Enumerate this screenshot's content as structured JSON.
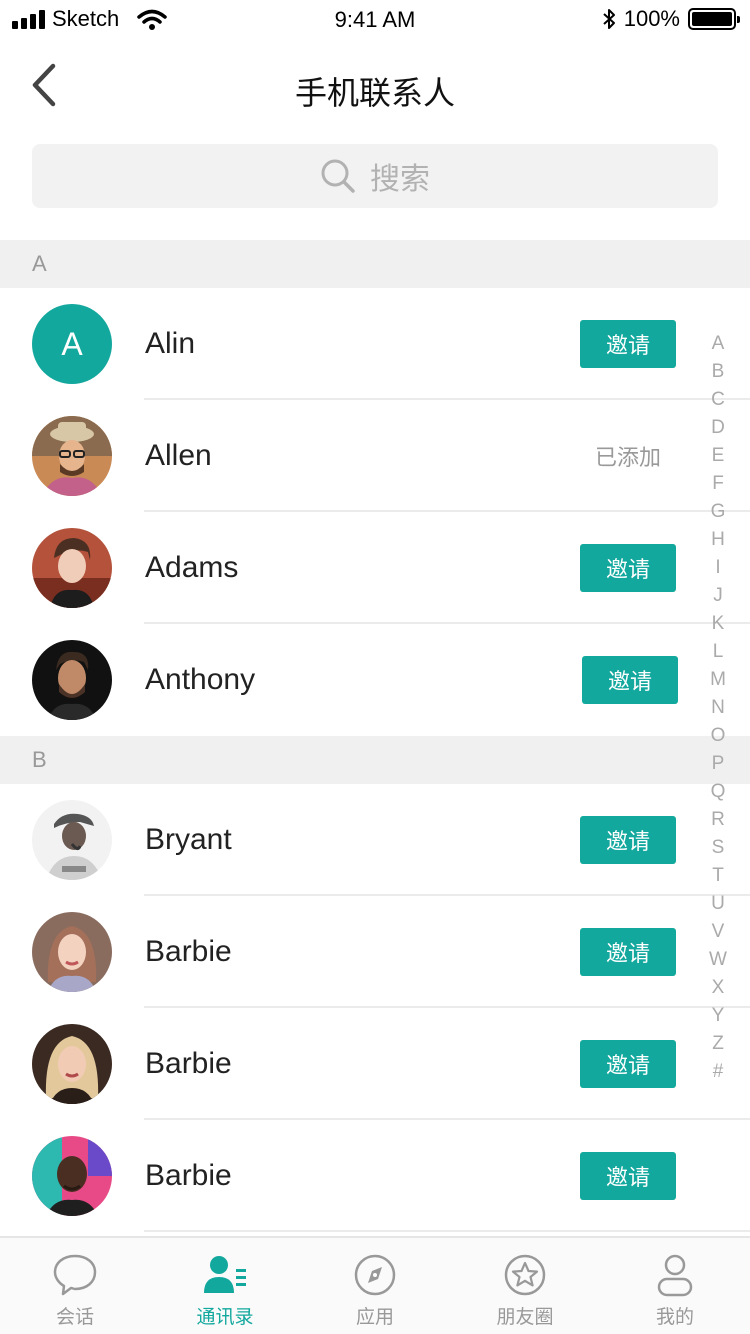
{
  "status_bar": {
    "carrier": "Sketch",
    "time": "9:41 AM",
    "battery": "100%"
  },
  "nav": {
    "title": "手机联系人"
  },
  "search": {
    "placeholder": "搜索"
  },
  "colors": {
    "accent": "#13a89e",
    "section_bg": "#f0f0f0"
  },
  "sections": [
    {
      "letter": "A",
      "contacts": [
        {
          "name": "Alin",
          "avatar": "letter-avatar",
          "avatar_letter": "A",
          "action": "邀请"
        },
        {
          "name": "Allen",
          "avatar": "photo-avatar",
          "status": "已添加"
        },
        {
          "name": "Adams",
          "avatar": "photo-avatar",
          "action": "邀请"
        },
        {
          "name": "Anthony",
          "avatar": "photo-avatar",
          "action": "邀请"
        }
      ]
    },
    {
      "letter": "B",
      "contacts": [
        {
          "name": "Bryant",
          "avatar": "photo-avatar",
          "action": "邀请"
        },
        {
          "name": "Barbie",
          "avatar": "photo-avatar",
          "action": "邀请"
        },
        {
          "name": "Barbie",
          "avatar": "photo-avatar",
          "action": "邀请"
        },
        {
          "name": "Barbie",
          "avatar": "photo-avatar",
          "action": "邀请"
        }
      ]
    }
  ],
  "index_letters": [
    "A",
    "B",
    "C",
    "D",
    "E",
    "F",
    "G",
    "H",
    "I",
    "J",
    "K",
    "L",
    "M",
    "N",
    "O",
    "P",
    "Q",
    "R",
    "S",
    "T",
    "U",
    "V",
    "W",
    "X",
    "Y",
    "Z",
    "#"
  ],
  "tabs": [
    {
      "label": "会话",
      "icon": "chat-bubble-icon"
    },
    {
      "label": "通讯录",
      "icon": "contacts-icon",
      "active": true
    },
    {
      "label": "应用",
      "icon": "compass-icon"
    },
    {
      "label": "朋友圈",
      "icon": "star-icon"
    },
    {
      "label": "我的",
      "icon": "user-icon"
    }
  ]
}
